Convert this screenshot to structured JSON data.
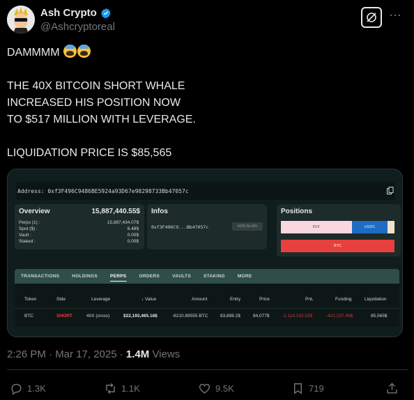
{
  "author": {
    "name": "Ash Crypto",
    "handle": "@Ashcryptoreal"
  },
  "tweet": {
    "line1": "DAMMMM",
    "line2": "THE 40X BITCOIN SHORT WHALE",
    "line3": "INCREASED HIS POSITION NOW",
    "line4": "TO $517 MILLION WITH LEVERAGE.",
    "line5": "LIQUIDATION PRICE IS $85,565"
  },
  "card": {
    "address_label": "Address: 0xf3F496C9486BE5924a93D67e98298733Bb47057c",
    "overview": {
      "title": "Overview",
      "total": "15,887,440.55$",
      "rows": [
        {
          "label": "Perps (1) :",
          "value": "15,887,434.07$"
        },
        {
          "label": "Spot ($) :",
          "value": "6.48$"
        },
        {
          "label": "Vault :",
          "value": "0.00$"
        },
        {
          "label": "Staked :",
          "value": "0.00$"
        }
      ]
    },
    "infos": {
      "title": "Infos",
      "address": "0xf3F496C9...Bb47057c",
      "alias_button": "ADD ALIAS"
    },
    "positions": {
      "title": "Positions",
      "seg1": "FLY",
      "seg2": "USDC",
      "btc": "BTC"
    },
    "tabs": [
      "TRANSACTIONS",
      "HOLDINGS",
      "PERPS",
      "ORDERS",
      "VAULTS",
      "STAKING",
      "MORE"
    ],
    "table": {
      "headers": [
        "Token",
        "Side",
        "Leverage",
        "↓ Value",
        "Amount",
        "Entry",
        "Price",
        "PnL",
        "Funding",
        "Liquidation"
      ],
      "row": [
        "BTC",
        "SHORT",
        "40X (cross)",
        "$22,193,465.16$",
        "-6210.89555 BTC",
        "83,898.2$",
        "84,077$",
        "-1,114,150.53$",
        "-421,237.49$",
        "85,565$"
      ]
    }
  },
  "meta": {
    "time": "2:26 PM · Mar 17, 2025 · ",
    "views_count": "1.4M",
    "views_label": " Views"
  },
  "actions": {
    "replies": "1.3K",
    "reposts": "1.1K",
    "likes": "9.5K",
    "bookmarks": "719"
  }
}
